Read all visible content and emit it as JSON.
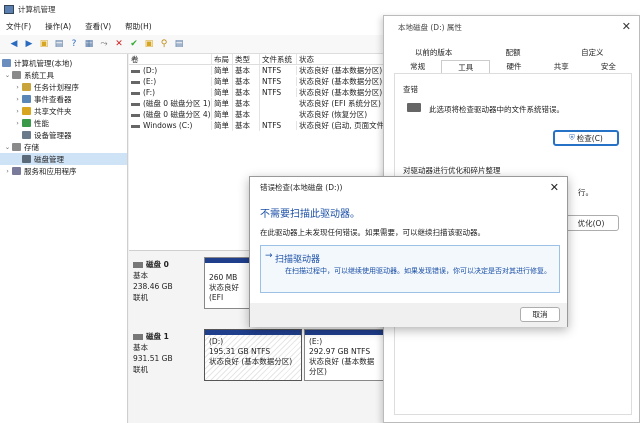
{
  "window": {
    "title": "计算机管理"
  },
  "menu": [
    "文件(F)",
    "操作(A)",
    "查看(V)",
    "帮助(H)"
  ],
  "tree": {
    "root": "计算机管理(本地)",
    "system_tools": "系统工具",
    "task_scheduler": "任务计划程序",
    "event_viewer": "事件查看器",
    "shared_folders": "共享文件夹",
    "performance": "性能",
    "device_manager": "设备管理器",
    "storage": "存储",
    "disk_management": "磁盘管理",
    "services_apps": "服务和应用程序"
  },
  "volume_table": {
    "headers": [
      "卷",
      "布局",
      "类型",
      "文件系统",
      "状态"
    ],
    "rows": [
      [
        "(D:)",
        "简单",
        "基本",
        "NTFS",
        "状态良好 (基本数据分区)"
      ],
      [
        "(E:)",
        "简单",
        "基本",
        "NTFS",
        "状态良好 (基本数据分区)"
      ],
      [
        "(F:)",
        "简单",
        "基本",
        "NTFS",
        "状态良好 (基本数据分区)"
      ],
      [
        "(磁盘 0 磁盘分区 1)",
        "简单",
        "基本",
        "",
        "状态良好 (EFI 系统分区)"
      ],
      [
        "(磁盘 0 磁盘分区 4)",
        "简单",
        "基本",
        "",
        "状态良好 (恢复分区)"
      ],
      [
        "Windows (C:)",
        "简单",
        "基本",
        "NTFS",
        "状态良好 (启动, 页面文件"
      ]
    ]
  },
  "disks": [
    {
      "name": "磁盘 0",
      "type": "基本",
      "size": "238.46 GB",
      "status": "联机",
      "partitions": [
        {
          "label": "",
          "size": "260 MB",
          "status": "状态良好 (EFI"
        }
      ]
    },
    {
      "name": "磁盘 1",
      "type": "基本",
      "size": "931.51 GB",
      "status": "联机",
      "partitions": [
        {
          "label": "(D:)",
          "size": "195.31 GB NTFS",
          "status": "状态良好 (基本数据分区)"
        },
        {
          "label": "(E:)",
          "size": "292.97 GB NTFS",
          "status": "状态良好 (基本数据分区)"
        }
      ]
    }
  ],
  "props": {
    "title": "本地磁盘 (D:) 属性",
    "tabs_row1": [
      "以前的版本",
      "配额",
      "自定义"
    ],
    "tabs_row2": [
      "常规",
      "工具",
      "硬件",
      "共享",
      "安全"
    ],
    "check_group": "查错",
    "check_desc": "此选项将检查驱动器中的文件系统错误。",
    "check_button": "检查(C)",
    "optimize_group": "对驱动器进行优化和碎片整理",
    "optimize_desc_tail": "行。",
    "optimize_button_tail": "优化(O)"
  },
  "errdlg": {
    "title": "错误检查(本地磁盘 (D:))",
    "heading": "不需要扫描此驱动器。",
    "desc": "在此驱动器上未发现任何错误。如果需要，可以继续扫描该驱动器。",
    "option_title": "扫描驱动器",
    "option_desc": "在扫描过程中，可以继续使用驱动器。如果发现错误，你可以决定是否对其进行修复。",
    "cancel": "取消"
  }
}
